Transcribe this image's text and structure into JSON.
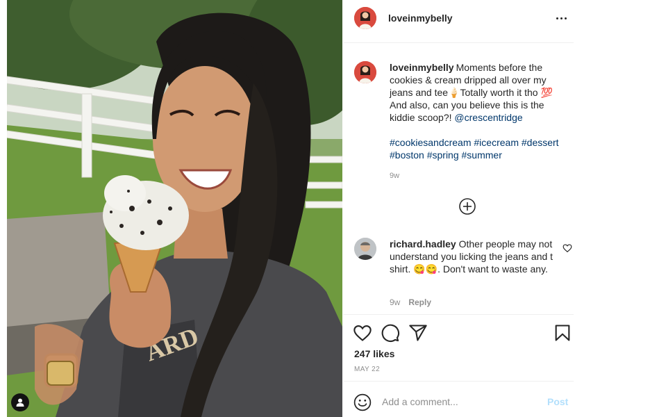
{
  "post": {
    "username": "loveinmybelly",
    "more_label": "…",
    "caption": {
      "username": "loveinmybelly",
      "text": "Moments before the cookies & cream dripped all over my jeans and tee🍦Totally worth it tho 💯 And also, can you believe this is the kiddie scoop?! ",
      "mention": "@crescentridge",
      "hashtags": "#cookiesandcream #icecream #dessert #boston #spring #summer",
      "time": "9w"
    },
    "comment": {
      "username": "richard.hadley",
      "text": "Other people may not understand you licking the jeans and t shirt. 😋😋. Don't want to waste any.",
      "time": "9w",
      "reply_label": "Reply"
    },
    "likes": "247 likes",
    "date": "MAY 22",
    "add_comment": {
      "placeholder": "Add a comment...",
      "post_label": "Post"
    }
  },
  "colors": {
    "accent": "#b2dffc",
    "link": "#00376b",
    "muted": "#8e8e8e"
  },
  "icons": [
    "more-icon",
    "add-circle-icon",
    "heart-icon",
    "comment-icon",
    "share-icon",
    "bookmark-icon",
    "emoji-icon",
    "user-tag-icon"
  ]
}
